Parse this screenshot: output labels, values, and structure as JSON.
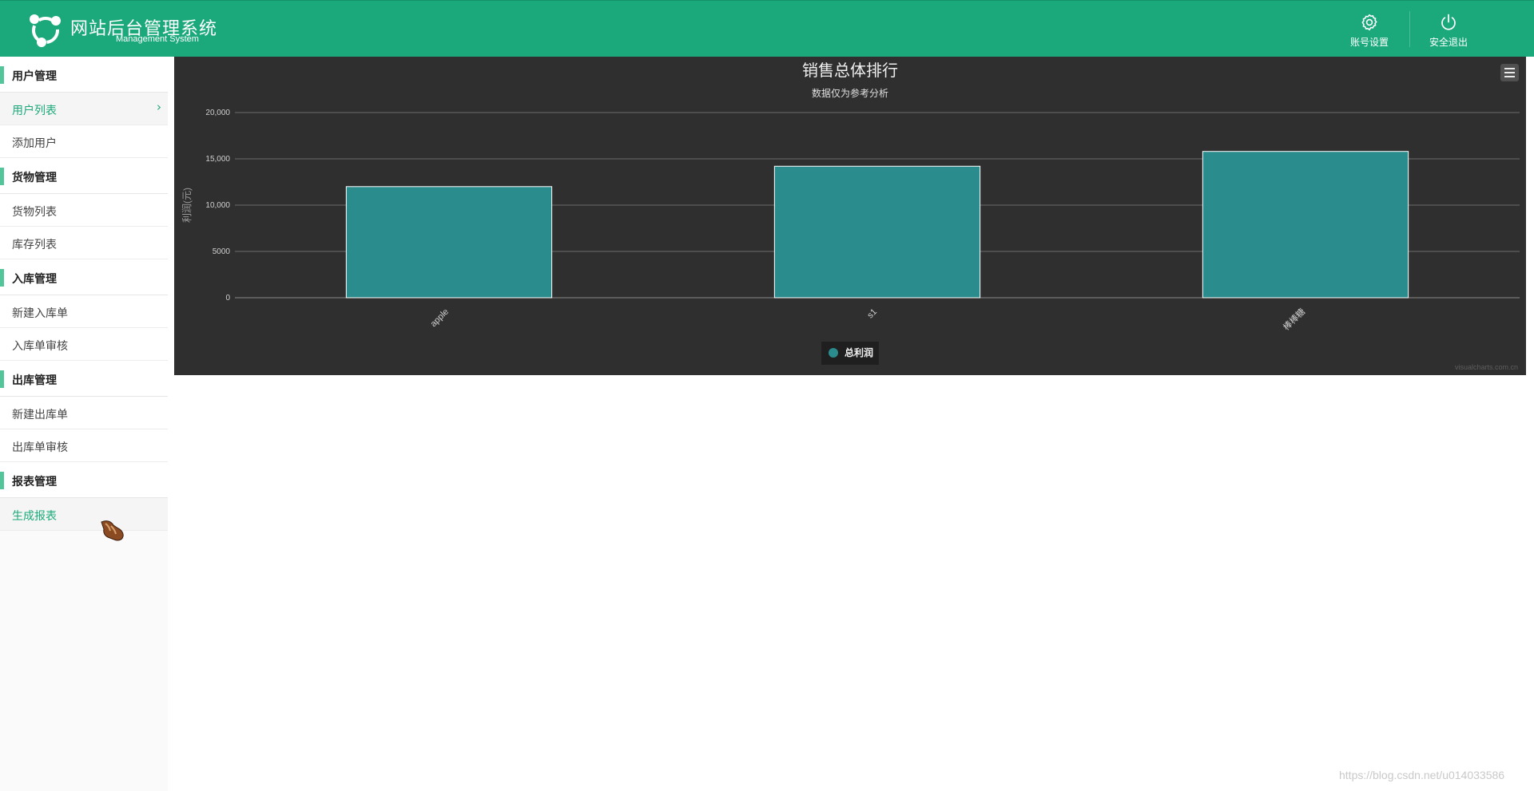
{
  "header": {
    "title": "网站后台管理系统",
    "subtitle": "Management System",
    "account_settings": "账号设置",
    "logout": "安全退出",
    "background_color": "#1ba97b"
  },
  "sidebar": {
    "groups": [
      {
        "title": "用户管理",
        "items": [
          {
            "label": "用户列表",
            "active": true
          },
          {
            "label": "添加用户",
            "active": false
          }
        ]
      },
      {
        "title": "货物管理",
        "items": [
          {
            "label": "货物列表",
            "active": false
          },
          {
            "label": "库存列表",
            "active": false
          }
        ]
      },
      {
        "title": "入库管理",
        "items": [
          {
            "label": "新建入库单",
            "active": false
          },
          {
            "label": "入库单审核",
            "active": false
          }
        ]
      },
      {
        "title": "出库管理",
        "items": [
          {
            "label": "新建出库单",
            "active": false
          },
          {
            "label": "出库单审核",
            "active": false
          }
        ]
      },
      {
        "title": "报表管理",
        "items": [
          {
            "label": "生成报表",
            "active": true
          }
        ]
      }
    ],
    "accent_color": "#52c69a"
  },
  "chart_data": {
    "type": "bar",
    "title": "销售总体排行",
    "subtitle": "数据仅为参考分析",
    "ylabel": "利润(元)",
    "xlabel": "",
    "categories": [
      "apple",
      "s1",
      "棒棒糖"
    ],
    "series": [
      {
        "name": "总利润",
        "values": [
          12000,
          14200,
          15800
        ],
        "color": "#2a8c8c"
      }
    ],
    "yticks": [
      "0",
      "5000",
      "10,000",
      "15,000",
      "20,000"
    ],
    "ylim": [
      0,
      20000
    ],
    "grid": true,
    "legend": "bottom-center",
    "background_color": "#2f2f2f",
    "credit": "visualcharts.com.cn"
  },
  "watermark": "https://blog.csdn.net/u014033586",
  "icons": {
    "logo": "logo-icon",
    "settings": "gear-icon",
    "logout": "power-icon",
    "menu": "hamburger-menu-icon",
    "chevron": "chevron-right-icon",
    "cursor": "hand-cursor-icon"
  }
}
